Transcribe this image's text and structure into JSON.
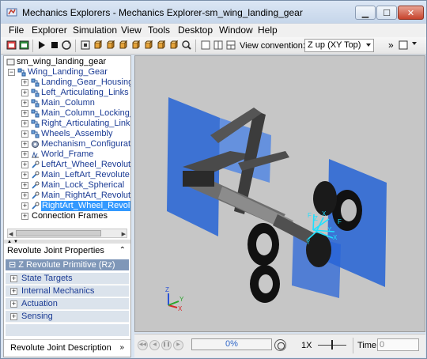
{
  "window": {
    "title": "Mechanics Explorers - Mechanics Explorer-sm_wing_landing_gear",
    "minimize_label": "▁",
    "maximize_label": "☐",
    "close_label": "✕"
  },
  "menu": [
    "File",
    "Explorer",
    "Simulation",
    "View",
    "Tools",
    "Desktop",
    "Window",
    "Help"
  ],
  "toolbar": {
    "view_convention_label": "View convention:",
    "view_convention_value": "Z up (XY Top)",
    "more_label": "»"
  },
  "tree": {
    "root": "sm_wing_landing_gear",
    "group": "Wing_Landing_Gear",
    "items": [
      {
        "label": "Landing_Gear_Housing",
        "type": "subsystem"
      },
      {
        "label": "Left_Articulating_Links",
        "type": "subsystem"
      },
      {
        "label": "Main_Column",
        "type": "subsystem"
      },
      {
        "label": "Main_Column_Locking_M",
        "type": "subsystem"
      },
      {
        "label": "Right_Articulating_Links",
        "type": "subsystem"
      },
      {
        "label": "Wheels_Assembly",
        "type": "subsystem"
      },
      {
        "label": "Mechanism_Configuratio",
        "type": "config"
      },
      {
        "label": "World_Frame",
        "type": "frame"
      },
      {
        "label": "LeftArt_Wheel_Revolute",
        "type": "joint"
      },
      {
        "label": "Main_LeftArt_Revolute",
        "type": "joint"
      },
      {
        "label": "Main_Lock_Spherical",
        "type": "joint"
      },
      {
        "label": "Main_RightArt_Revolute",
        "type": "joint"
      },
      {
        "label": "RightArt_Wheel_Revolut",
        "type": "joint",
        "selected": true
      }
    ],
    "connection_frames": "Connection Frames"
  },
  "properties": {
    "header": "Revolute Joint Properties",
    "collapse_glyph": "»",
    "primitive": "Z Revolute Primitive (Rz)",
    "primitive_glyph": "⊟",
    "groups": [
      "State Targets",
      "Internal Mechanics",
      "Actuation",
      "Sensing"
    ]
  },
  "description": {
    "header": "Revolute Joint Description",
    "chev": "»"
  },
  "viewer": {
    "triad_labels": {
      "x": "X",
      "y": "Y",
      "z": "Z"
    },
    "frame_labels": [
      "F",
      "X",
      "Z",
      "Y",
      "X",
      "F",
      "Y"
    ]
  },
  "playback": {
    "progress": "0%",
    "progress_value": 0,
    "speed": "1X",
    "time_label": "Time",
    "time_value": "0"
  },
  "colors": {
    "title_bg": "#c6d6ea",
    "selection": "#3399ff",
    "primitive_bar": "#7f97b8",
    "viewer_bg": "#c6c6c6",
    "housing_blue": "#1f5fd6",
    "frame_cyan": "#1fe0ff"
  }
}
